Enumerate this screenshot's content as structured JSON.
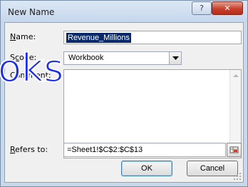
{
  "window": {
    "title": "New Name",
    "help_button": "?",
    "close_button": "✕"
  },
  "form": {
    "name_label_u": "N",
    "name_label_rest": "ame:",
    "name_value": "Revenue_Millions",
    "scope_label_prefix": "S",
    "scope_label_u": "c",
    "scope_label_rest": "ope:",
    "scope_value": "Workbook",
    "comment_label_u": "C",
    "comment_label_rest": "omment:",
    "refers_label_u": "R",
    "refers_label_rest": "efers to:",
    "refers_value": "=Sheet1!$C$2:$C$13"
  },
  "buttons": {
    "ok": "OK",
    "cancel": "Cancel"
  },
  "watermark": {
    "text": "oks"
  }
}
